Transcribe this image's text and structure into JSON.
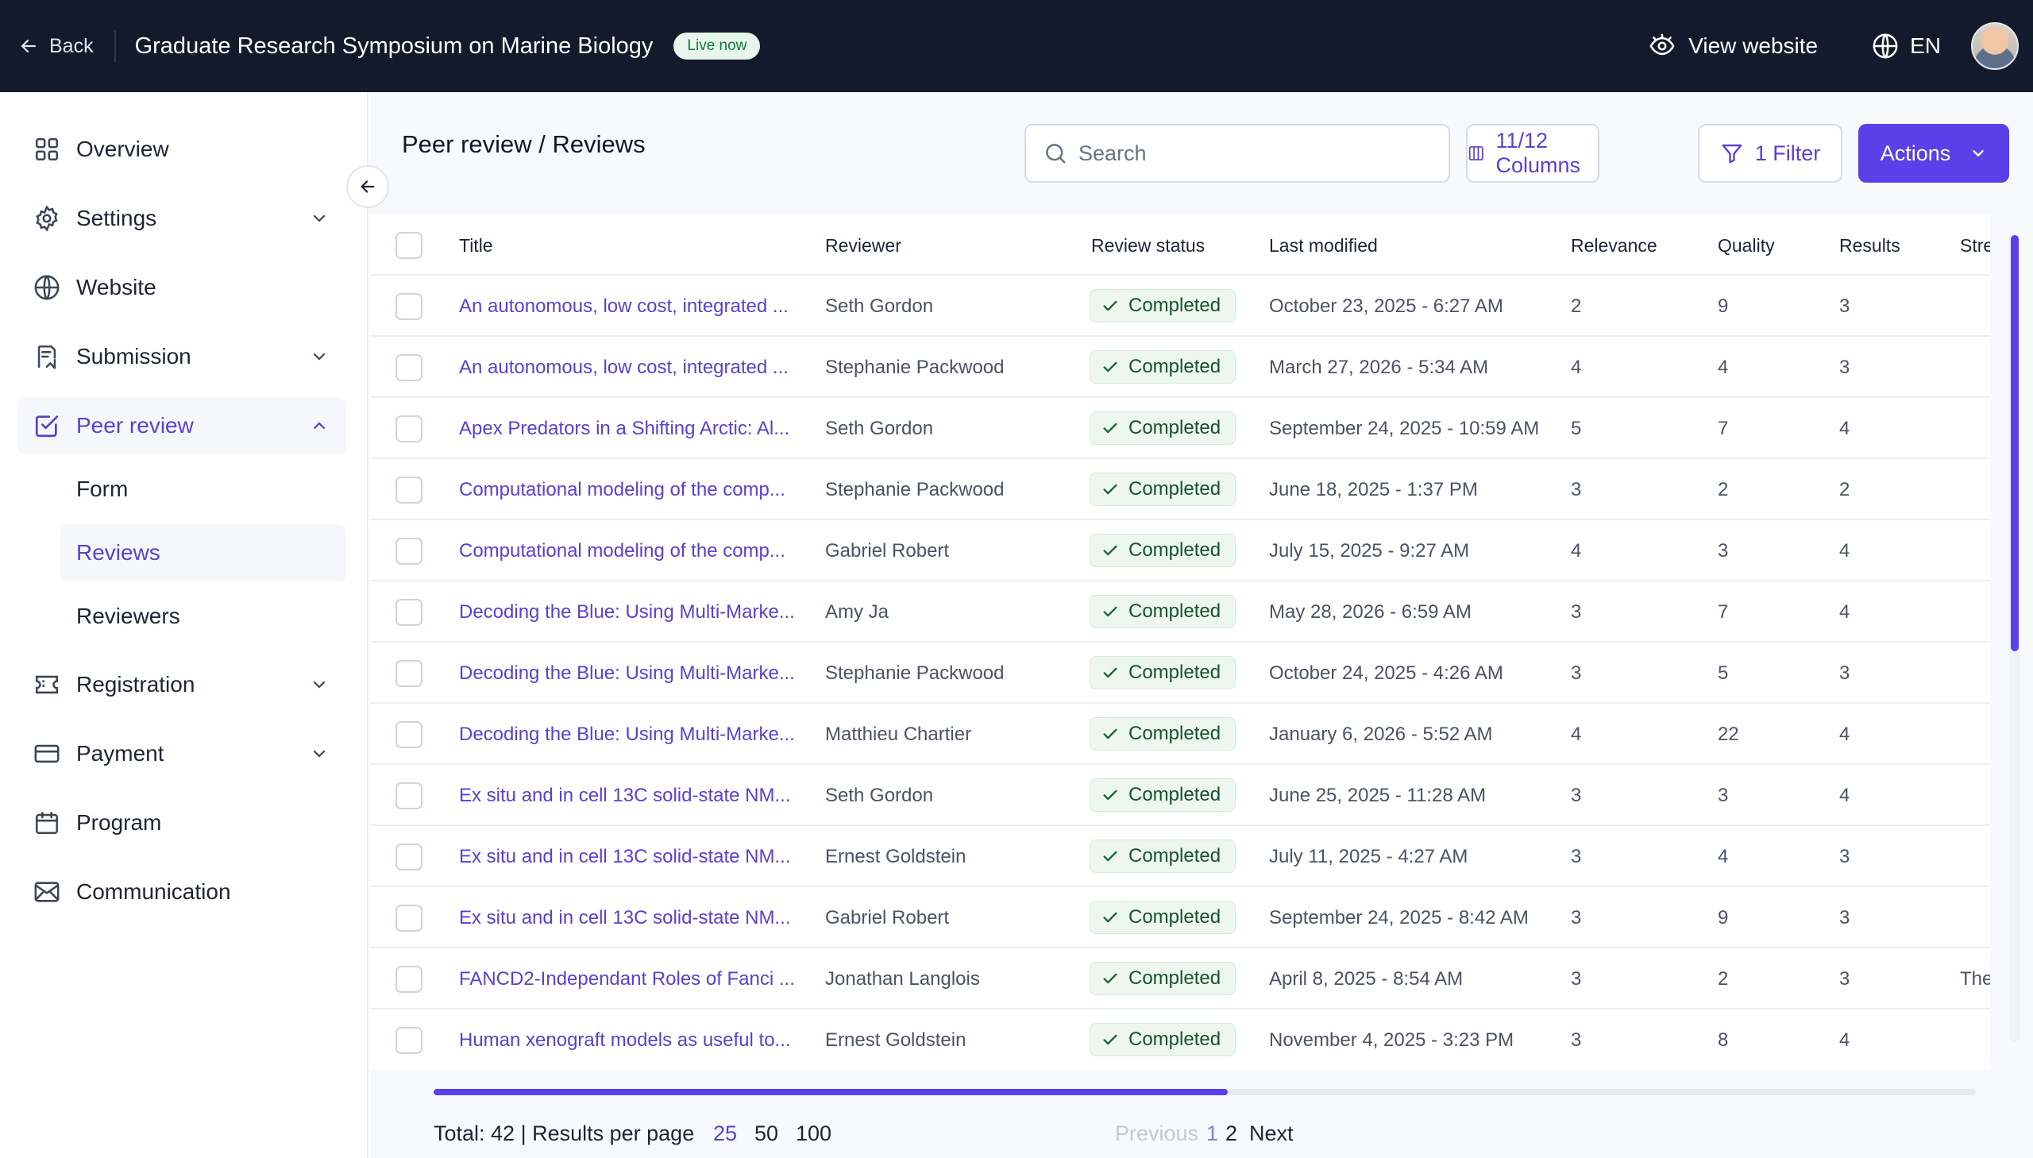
{
  "topbar": {
    "back_label": "Back",
    "event_title": "Graduate Research Symposium on Marine Biology",
    "live_badge": "Live now",
    "view_website_label": "View website",
    "language": "EN"
  },
  "sidebar": {
    "items": [
      {
        "label": "Overview",
        "icon": "grid-icon"
      },
      {
        "label": "Settings",
        "icon": "gear-icon"
      },
      {
        "label": "Website",
        "icon": "globe-icon"
      },
      {
        "label": "Submission",
        "icon": "submission-icon"
      },
      {
        "label": "Peer review",
        "icon": "checkbox-icon"
      },
      {
        "label": "Registration",
        "icon": "ticket-icon"
      },
      {
        "label": "Payment",
        "icon": "card-icon"
      },
      {
        "label": "Program",
        "icon": "calendar-icon"
      },
      {
        "label": "Communication",
        "icon": "mail-icon"
      }
    ],
    "peer_review_sub": [
      {
        "label": "Form"
      },
      {
        "label": "Reviews"
      },
      {
        "label": "Reviewers"
      }
    ]
  },
  "main": {
    "breadcrumb": "Peer review / Reviews",
    "search_placeholder": "Search",
    "columns_button": "11/12 Columns",
    "filter_button": "1 Filter",
    "actions_button": "Actions"
  },
  "table": {
    "headers": [
      "Title",
      "Reviewer",
      "Review status",
      "Last modified",
      "Relevance",
      "Quality",
      "Results",
      "Stre"
    ],
    "rows": [
      {
        "title": "An autonomous, low cost, integrated ...",
        "reviewer": "Seth Gordon",
        "status": "Completed",
        "modified": "October 23, 2025 - 6:27 AM",
        "relevance": "2",
        "quality": "9",
        "results": "3",
        "extra": ""
      },
      {
        "title": "An autonomous, low cost, integrated ...",
        "reviewer": "Stephanie Packwood",
        "status": "Completed",
        "modified": "March 27, 2026 - 5:34 AM",
        "relevance": "4",
        "quality": "4",
        "results": "3",
        "extra": ""
      },
      {
        "title": "Apex Predators in a Shifting Arctic: Al...",
        "reviewer": "Seth Gordon",
        "status": "Completed",
        "modified": "September 24, 2025 - 10:59 AM",
        "relevance": "5",
        "quality": "7",
        "results": "4",
        "extra": ""
      },
      {
        "title": "Computational modeling of the comp...",
        "reviewer": "Stephanie Packwood",
        "status": "Completed",
        "modified": "June 18, 2025 - 1:37 PM",
        "relevance": "3",
        "quality": "2",
        "results": "2",
        "extra": ""
      },
      {
        "title": "Computational modeling of the comp...",
        "reviewer": "Gabriel Robert",
        "status": "Completed",
        "modified": "July 15, 2025 - 9:27 AM",
        "relevance": "4",
        "quality": "3",
        "results": "4",
        "extra": ""
      },
      {
        "title": "Decoding the Blue: Using Multi-Marke...",
        "reviewer": "Amy Ja",
        "status": "Completed",
        "modified": "May 28, 2026 - 6:59 AM",
        "relevance": "3",
        "quality": "7",
        "results": "4",
        "extra": ""
      },
      {
        "title": "Decoding the Blue: Using Multi-Marke...",
        "reviewer": "Stephanie Packwood",
        "status": "Completed",
        "modified": "October 24, 2025 - 4:26 AM",
        "relevance": "3",
        "quality": "5",
        "results": "3",
        "extra": ""
      },
      {
        "title": "Decoding the Blue: Using Multi-Marke...",
        "reviewer": "Matthieu Chartier",
        "status": "Completed",
        "modified": "January 6, 2026 - 5:52 AM",
        "relevance": "4",
        "quality": "22",
        "results": "4",
        "extra": ""
      },
      {
        "title": "Ex situ and in cell 13C solid-state NM...",
        "reviewer": "Seth Gordon",
        "status": "Completed",
        "modified": "June 25, 2025 - 11:28 AM",
        "relevance": "3",
        "quality": "3",
        "results": "4",
        "extra": ""
      },
      {
        "title": "Ex situ and in cell 13C solid-state NM...",
        "reviewer": "Ernest Goldstein",
        "status": "Completed",
        "modified": "July 11, 2025 - 4:27 AM",
        "relevance": "3",
        "quality": "4",
        "results": "3",
        "extra": ""
      },
      {
        "title": "Ex situ and in cell 13C solid-state NM...",
        "reviewer": "Gabriel Robert",
        "status": "Completed",
        "modified": "September 24, 2025 - 8:42 AM",
        "relevance": "3",
        "quality": "9",
        "results": "3",
        "extra": ""
      },
      {
        "title": "FANCD2-Independant Roles of Fanci ...",
        "reviewer": "Jonathan Langlois",
        "status": "Completed",
        "modified": "April 8, 2025 - 8:54 AM",
        "relevance": "3",
        "quality": "2",
        "results": "3",
        "extra": "The"
      },
      {
        "title": "Human xenograft models as useful to...",
        "reviewer": "Ernest Goldstein",
        "status": "Completed",
        "modified": "November 4, 2025 - 3:23 PM",
        "relevance": "3",
        "quality": "8",
        "results": "4",
        "extra": ""
      }
    ]
  },
  "footer": {
    "total_label": "Total: 42 | Results per page",
    "per_page_options": [
      "25",
      "50",
      "100"
    ],
    "selected_per_page": "25",
    "previous_label": "Previous",
    "pages": [
      "1",
      "2"
    ],
    "current_page": "1",
    "next_label": "Next"
  },
  "colors": {
    "topbar_bg": "#131a2c",
    "accent": "#5b3fe8",
    "link": "#5b3fd1",
    "status_bg": "#eef6f0",
    "status_text": "#14532d"
  }
}
